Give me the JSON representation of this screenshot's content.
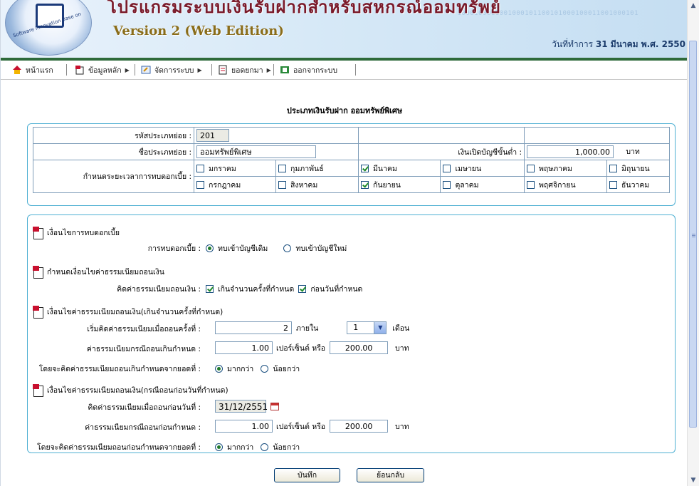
{
  "header": {
    "title": "โปรแกรมระบบเงินรับฝากสำหรับสหกรณ์ออมทรัพย์",
    "version": "Version 2 (Web Edition)",
    "binary_text": "1000100011001000101100101000100011001000101",
    "logo_arc_text": "Software Innovation Base on",
    "date_label": "วันที่ทำการ",
    "date_value": "31 มีนาคม พ.ศ. 2550"
  },
  "menu": {
    "items": [
      {
        "label": "หน้าแรก",
        "icon": "home-icon"
      },
      {
        "label": "ข้อมูลหลัก",
        "icon": "folder-icon"
      },
      {
        "label": "จัดการระบบ",
        "icon": "settings-icon"
      },
      {
        "label": "ยอดยกมา",
        "icon": "document-icon"
      },
      {
        "label": "ออกจากระบบ",
        "icon": "exit-icon"
      }
    ],
    "arrow": "▶"
  },
  "page_heading": "ประเภทเงินรับฝาก ออมทรัพย์พิเศษ",
  "info": {
    "code_label": "รหัสประเภทย่อย :",
    "code_value": "201",
    "name_label": "ชื่อประเภทย่อย :",
    "name_value": "ออมทรัพย์พิเศษ",
    "min_label": "เงินเปิดบัญชีขั้นต่ำ :",
    "min_value": "1,000.00",
    "min_unit": "บาท",
    "period_label": "กำหนดระยะเวลาการทบดอกเบี้ย :",
    "months": [
      {
        "name": "มกราคม",
        "checked": false
      },
      {
        "name": "กุมภาพันธ์",
        "checked": false
      },
      {
        "name": "มีนาคม",
        "checked": true
      },
      {
        "name": "เมษายน",
        "checked": false
      },
      {
        "name": "พฤษภาคม",
        "checked": false
      },
      {
        "name": "มิถุนายน",
        "checked": false
      },
      {
        "name": "กรกฎาคม",
        "checked": false
      },
      {
        "name": "สิงหาคม",
        "checked": false
      },
      {
        "name": "กันยายน",
        "checked": true
      },
      {
        "name": "ตุลาคม",
        "checked": false
      },
      {
        "name": "พฤศจิกายน",
        "checked": false
      },
      {
        "name": "ธันวาคม",
        "checked": false
      }
    ]
  },
  "conditions": {
    "interest_section": "เงื่อนไขการทบดอกเบี้ย",
    "interest_label": "การทบดอกเบี้ย :",
    "interest_opt1": "ทบเข้าบัญชีเดิม",
    "interest_opt2": "ทบเข้าบัญชีใหม่",
    "fee_section": "กำหนดเงื่อนไขค่าธรรมเนียมถอนเงิน",
    "fee_label": "คิดค่าธรรมเนียมถอนเงิน :",
    "fee_opt1": "เกินจำนวนครั้งที่กำหนด",
    "fee_opt2": "ก่อนวันที่กำหนด",
    "over_section": "เงื่อนไขค่าธรรมเนียมถอนเงิน(เกินจำนวนครั้งที่กำหนด)",
    "over_start_label": "เริ่มคิดค่าธรรมเนียมเมื่อถอนครั้งที่ :",
    "over_start_value": "2",
    "within_label": "ภายใน",
    "within_value": "1",
    "month_unit": "เดือน",
    "over_fee_label": "ค่าธรรมเนียมกรณีถอนเกินกำหนด :",
    "over_fee_percent": "1.00",
    "percent_or": "เปอร์เซ็นต์ หรือ",
    "over_fee_baht": "200.00",
    "baht": "บาท",
    "over_calc_label": "โดยจะคิดค่าธรรมเนียมถอนเกินกำหนดจากยอดที่ :",
    "more": "มากกว่า",
    "less": "น้อยกว่า",
    "early_section": "เงื่อนไขค่าธรรมเนียมถอนเงิน(กรณีถอนก่อนวันที่กำหนด)",
    "early_date_label": "คิดค่าธรรมเนียมเมื่อถอนก่อนวันที่ :",
    "early_date_value": "31/12/2551",
    "early_fee_label": "ค่าธรรมเนียมกรณีถอนก่อนกำหนด :",
    "early_fee_percent": "1.00",
    "early_fee_baht": "200.00",
    "early_calc_label": "โดยจะคิดค่าธรรมเนียมถอนก่อนกำหนดจากยอดที่ :"
  },
  "buttons": {
    "save": "บันทึก",
    "back": "ย้อนกลับ"
  },
  "scroll": {
    "up": "▲",
    "down": "▼"
  },
  "colors": {
    "box_border": "#4fb0d3",
    "banner_line": "#2e6a3a",
    "check_green": "#1f8a2a"
  }
}
